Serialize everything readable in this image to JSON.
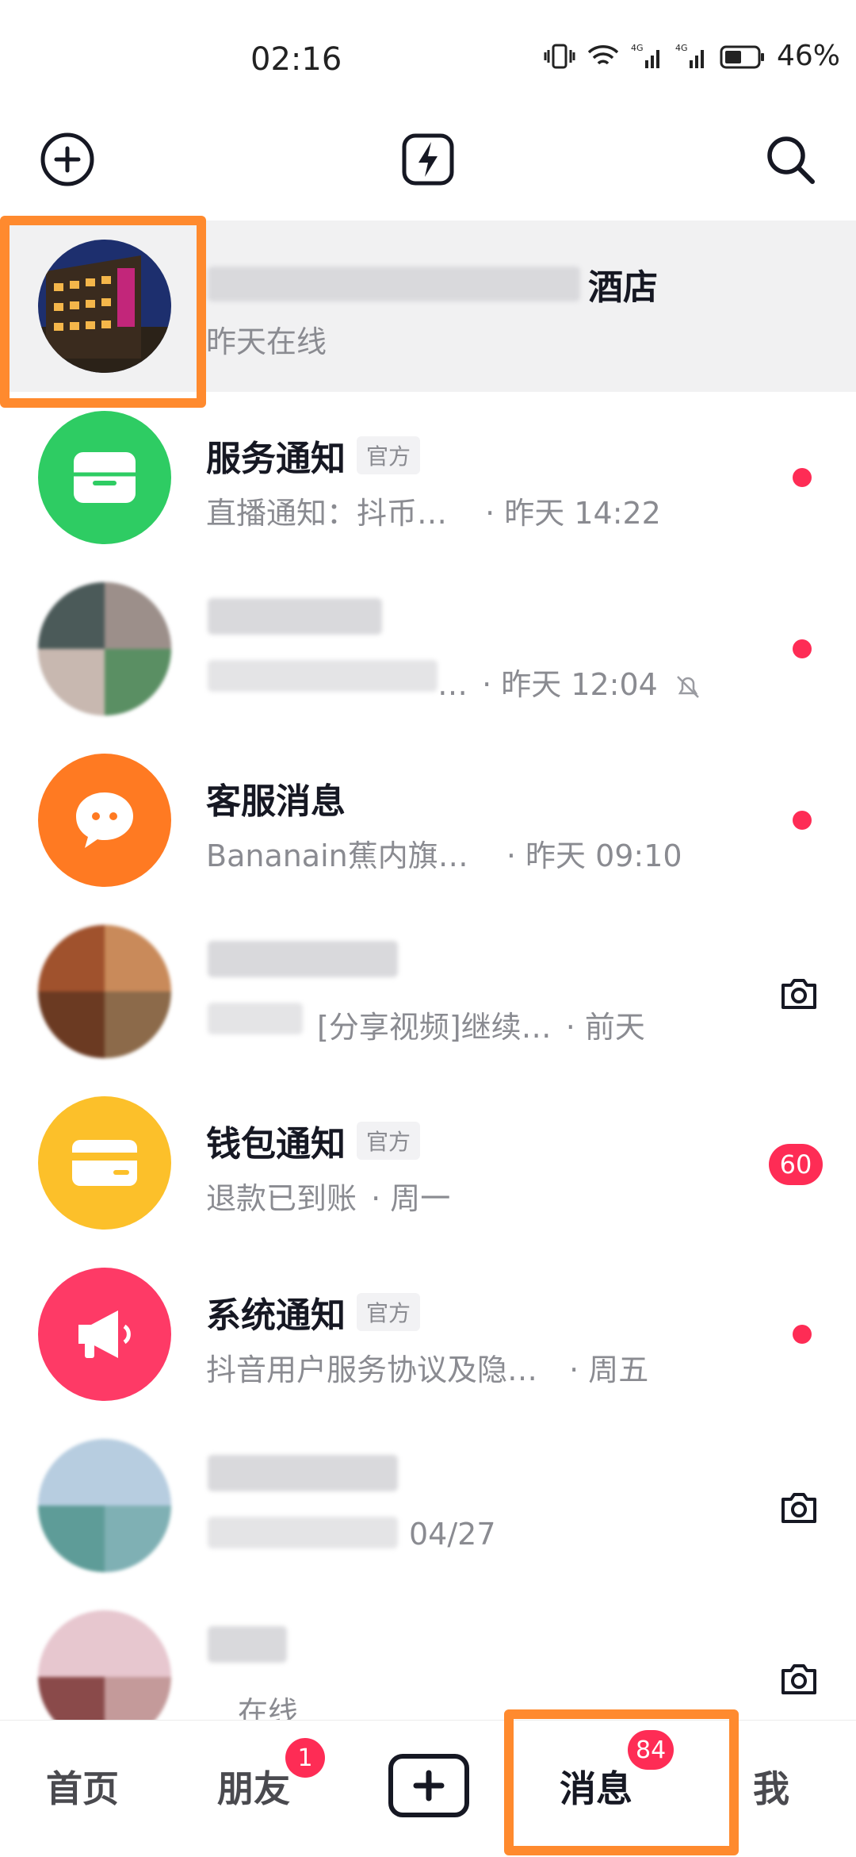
{
  "status_bar": {
    "time": "02:16",
    "battery": "46%",
    "network": "4G"
  },
  "header": {
    "add_icon": "plus-circle-icon",
    "flash_icon": "lightning-icon",
    "search_icon": "search-icon"
  },
  "conversations": [
    {
      "title": "酒店",
      "subtitle": "昨天在线",
      "avatar": "hotel-photo",
      "indicator": "none"
    },
    {
      "title": "服务通知",
      "tag": "官方",
      "preview": "直播通知：抖币…",
      "time": "· 昨天 14:22",
      "avatar": "service-box-icon",
      "indicator": "dot"
    },
    {
      "preview": "…",
      "time": "· 昨天 12:04",
      "avatar": "blurred-user",
      "indicator": "dot",
      "muted": true
    },
    {
      "title": "客服消息",
      "preview": "Bananain蕉内旗…",
      "time": "· 昨天 09:10",
      "avatar": "chat-bubble-icon",
      "indicator": "dot"
    },
    {
      "preview": "[分享视频]继续…",
      "time": "· 前天",
      "avatar": "blurred-user",
      "indicator": "camera"
    },
    {
      "title": "钱包通知",
      "tag": "官方",
      "preview": "退款已到账",
      "time": "· 周一",
      "avatar": "wallet-card-icon",
      "indicator": "badge",
      "badge": "60"
    },
    {
      "title": "系统通知",
      "tag": "官方",
      "preview": "抖音用户服务协议及隐…",
      "time": "· 周五",
      "avatar": "megaphone-icon",
      "indicator": "dot"
    },
    {
      "time": "04/27",
      "avatar": "blurred-user",
      "indicator": "camera"
    },
    {
      "preview": "在线",
      "avatar": "blurred-user",
      "indicator": "camera"
    }
  ],
  "tabbar": {
    "home": "首页",
    "friends": "朋友",
    "friends_badge": "1",
    "messages": "消息",
    "messages_badge": "84",
    "me": "我"
  },
  "colors": {
    "accent": "#fe2c55",
    "annotation": "#ff8a2e"
  }
}
